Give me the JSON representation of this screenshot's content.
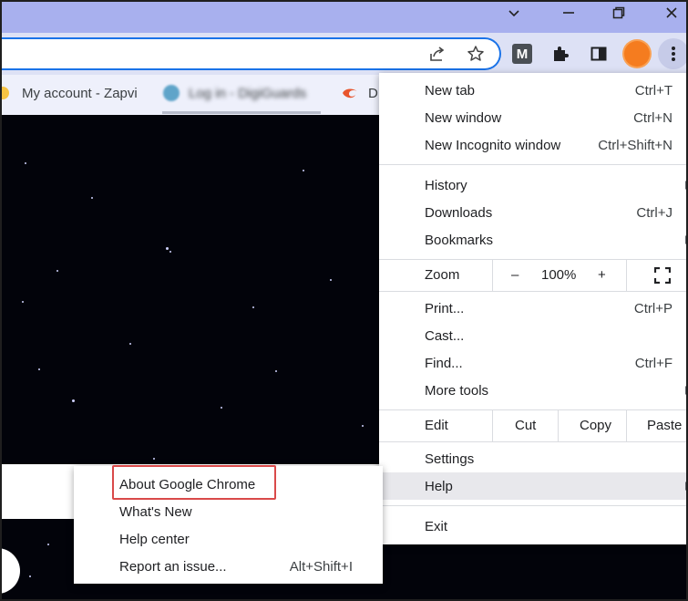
{
  "window": {
    "controls": {
      "minimize": "minimize",
      "restore": "restore",
      "close": "close"
    }
  },
  "toolbar": {
    "icons": [
      "share-icon",
      "bookmark-star-icon",
      "extension-m-icon",
      "extensions-puzzle-icon",
      "side-panel-icon",
      "profile-avatar",
      "more-menu-icon"
    ],
    "avatar_color": "#f57c1f",
    "extension_m_letter": "M"
  },
  "bookmarks": [
    {
      "label": "My account - Zapvi"
    },
    {
      "label": "Log in - DigiGuards",
      "blurred": true
    },
    {
      "label": "D"
    }
  ],
  "menu": {
    "new_tab": {
      "label": "New tab",
      "shortcut": "Ctrl+T"
    },
    "new_window": {
      "label": "New window",
      "shortcut": "Ctrl+N"
    },
    "new_incognito": {
      "label": "New Incognito window",
      "shortcut": "Ctrl+Shift+N"
    },
    "history": {
      "label": "History"
    },
    "downloads": {
      "label": "Downloads",
      "shortcut": "Ctrl+J"
    },
    "bookmarks": {
      "label": "Bookmarks"
    },
    "zoom": {
      "label": "Zoom",
      "minus": "–",
      "value": "100%",
      "plus": "+"
    },
    "print": {
      "label": "Print...",
      "shortcut": "Ctrl+P"
    },
    "cast": {
      "label": "Cast..."
    },
    "find": {
      "label": "Find...",
      "shortcut": "Ctrl+F"
    },
    "more_tools": {
      "label": "More tools"
    },
    "edit": {
      "label": "Edit",
      "cut": "Cut",
      "copy": "Copy",
      "paste": "Paste"
    },
    "settings": {
      "label": "Settings"
    },
    "help": {
      "label": "Help"
    },
    "exit": {
      "label": "Exit"
    }
  },
  "help_submenu": {
    "about": {
      "label": "About Google Chrome"
    },
    "whats_new": {
      "label": "What's New"
    },
    "help_center": {
      "label": "Help center"
    },
    "report_issue": {
      "label": "Report an issue...",
      "shortcut": "Alt+Shift+I"
    }
  },
  "colors": {
    "titlebar": "#a8b0ee",
    "highlight_box": "#d94a4a",
    "omnibox_focus": "#1a73e8"
  }
}
